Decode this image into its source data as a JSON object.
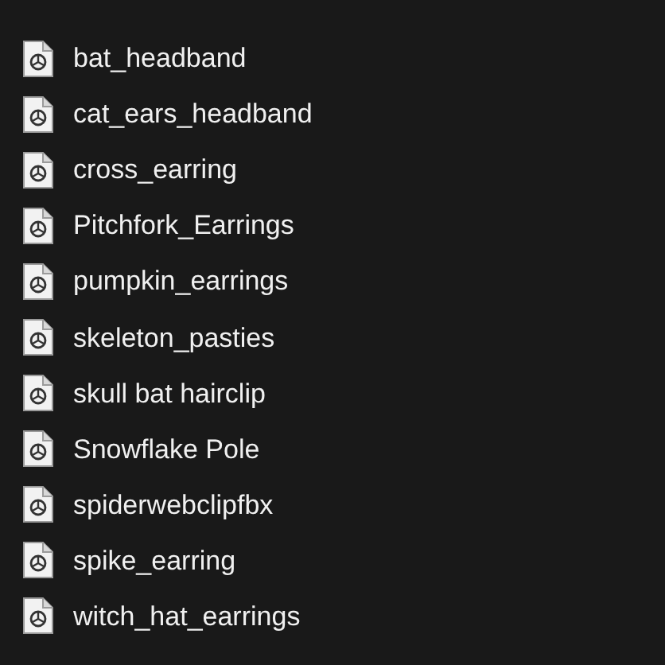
{
  "files": [
    {
      "name": "bat_headband"
    },
    {
      "name": "cat_ears_headband"
    },
    {
      "name": "cross_earring"
    },
    {
      "name": "Pitchfork_Earrings"
    },
    {
      "name": "pumpkin_earrings"
    },
    {
      "name": "skeleton_pasties"
    },
    {
      "name": "skull bat hairclip"
    },
    {
      "name": "Snowflake Pole"
    },
    {
      "name": "spiderwebclipfbx"
    },
    {
      "name": "spike_earring"
    },
    {
      "name": "witch_hat_earrings"
    }
  ]
}
